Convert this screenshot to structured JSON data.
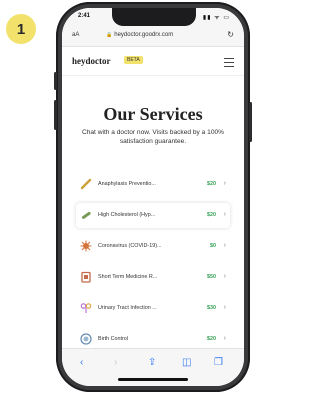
{
  "step_number": "1",
  "status_bar": {
    "time": "2:41",
    "icons": "▮▮ ᯤ ▭"
  },
  "browser": {
    "aa_label": "aA",
    "url": "heydoctor.goodrx.com",
    "reload_icon": "reload-icon"
  },
  "site": {
    "logo": "heydoctor",
    "badge": "BETA",
    "menu_icon": "hamburger-icon"
  },
  "page": {
    "title": "Our Services",
    "subtitle": "Chat with a doctor now. Visits backed by a 100% satisfaction guarantee."
  },
  "services": [
    {
      "name": "Anaphylaxis Preventio...",
      "price": "$20",
      "icon": "epipen-icon",
      "color": "#c9a13b"
    },
    {
      "name": "High Cholesterol (Hyp...",
      "price": "$20",
      "icon": "pill-bottle-icon",
      "color": "#7a9a5a"
    },
    {
      "name": "Coronavirus (COVID-19)...",
      "price": "$0",
      "icon": "virus-icon",
      "color": "#d4733a"
    },
    {
      "name": "Short Term Medicine R...",
      "price": "$50",
      "icon": "medicine-box-icon",
      "color": "#c46a4a"
    },
    {
      "name": "Urinary Tract Infection ...",
      "price": "$30",
      "icon": "uti-icon",
      "color": "#b36ad1"
    },
    {
      "name": "Birth Control",
      "price": "$20",
      "icon": "birth-control-icon",
      "color": "#6a8fb3"
    }
  ],
  "toolbar": {
    "back": "‹",
    "forward": "›",
    "share": "⇪",
    "bookmarks": "◫",
    "tabs": "❐"
  }
}
